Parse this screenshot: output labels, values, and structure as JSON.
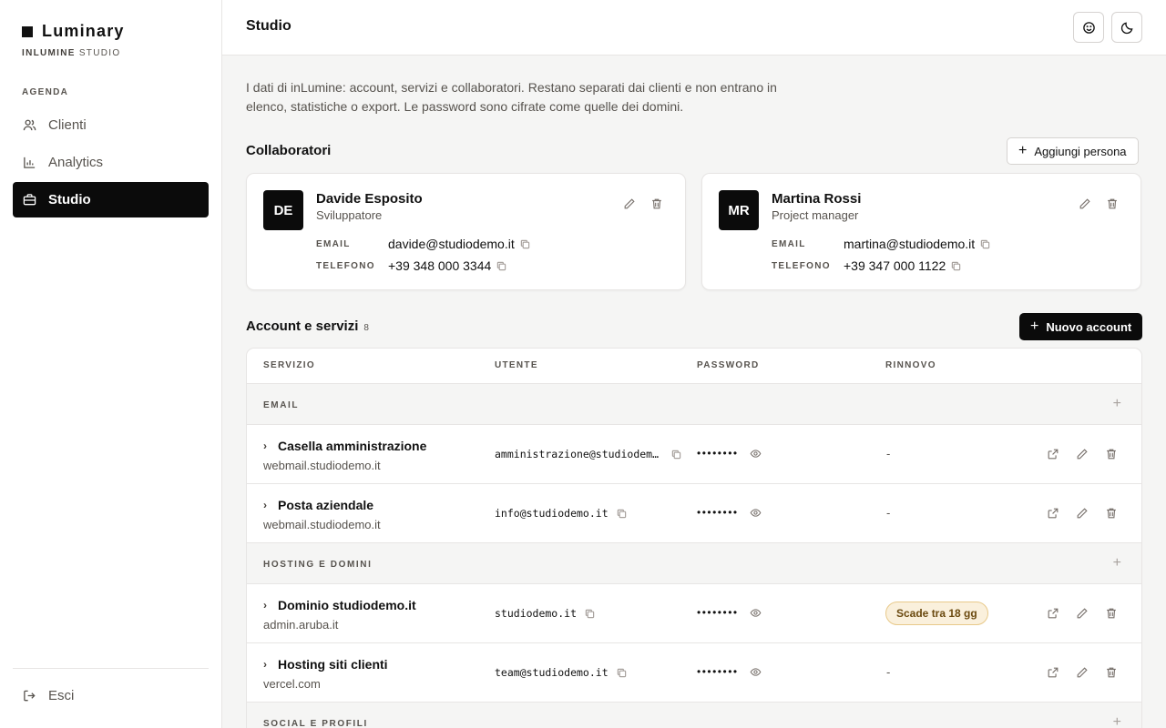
{
  "sidebar": {
    "brand": "Luminary",
    "brand_sub_bold": "INLUMINE",
    "brand_sub_rest": "STUDIO",
    "section": "AGENDA",
    "items": [
      {
        "label": "Clienti",
        "icon": "users-icon"
      },
      {
        "label": "Analytics",
        "icon": "bar-chart-icon"
      },
      {
        "label": "Studio",
        "icon": "briefcase-icon",
        "active": true
      }
    ],
    "logout": "Esci"
  },
  "header": {
    "title": "Studio",
    "buttons": [
      "smile-icon",
      "moon-icon"
    ]
  },
  "intro": "I dati di inLumine: account, servizi e collaboratori. Restano separati dai clienti e non entrano in elenco, statistiche o export. Le password sono cifrate come quelle dei domini.",
  "collaboratori": {
    "title": "Collaboratori",
    "add_label": "Aggiungi persona",
    "email_key": "EMAIL",
    "phone_key": "TELEFONO",
    "people": [
      {
        "initials": "DE",
        "name": "Davide Esposito",
        "role": "Sviluppatore",
        "email": "davide@studiodemo.it",
        "phone": "+39 348 000 3344"
      },
      {
        "initials": "MR",
        "name": "Martina Rossi",
        "role": "Project manager",
        "email": "martina@studiodemo.it",
        "phone": "+39 347 000 1122"
      }
    ]
  },
  "accounts": {
    "title": "Account e servizi",
    "count": "8",
    "new_label": "Nuovo account",
    "columns": [
      "SERVIZIO",
      "UTENTE",
      "PASSWORD",
      "RINNOVO"
    ],
    "groups": [
      {
        "label": "EMAIL",
        "rows": [
          {
            "name": "Casella amministrazione",
            "host": "webmail.studiodemo.it",
            "user": "amministrazione@studiodemo.it",
            "password": "••••••••",
            "renew": "-"
          },
          {
            "name": "Posta aziendale",
            "host": "webmail.studiodemo.it",
            "user": "info@studiodemo.it",
            "password": "••••••••",
            "renew": "-"
          }
        ]
      },
      {
        "label": "HOSTING E DOMINI",
        "rows": [
          {
            "name": "Dominio studiodemo.it",
            "host": "admin.aruba.it",
            "user": "studiodemo.it",
            "password": "••••••••",
            "renew": "Scade tra 18 gg",
            "badge": true
          },
          {
            "name": "Hosting siti clienti",
            "host": "vercel.com",
            "user": "team@studiodemo.it",
            "password": "••••••••",
            "renew": "-"
          }
        ]
      },
      {
        "label": "SOCIAL E PROFILI",
        "rows": []
      }
    ]
  },
  "colors": {
    "accent": "#0b0b0b",
    "badge_bg": "#faf0dc",
    "badge_border": "#e8c98a"
  }
}
